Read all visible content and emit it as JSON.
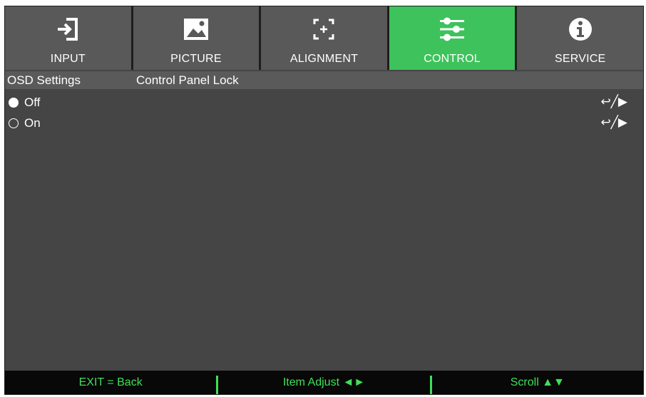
{
  "tabs": [
    {
      "label": "INPUT",
      "icon": "input-icon",
      "active": false
    },
    {
      "label": "PICTURE",
      "icon": "picture-icon",
      "active": false
    },
    {
      "label": "ALIGNMENT",
      "icon": "alignment-icon",
      "active": false
    },
    {
      "label": "CONTROL",
      "icon": "control-sliders-icon",
      "active": true
    },
    {
      "label": "SERVICE",
      "icon": "info-icon",
      "active": false
    }
  ],
  "breadcrumb": {
    "section": "OSD Settings",
    "page": "Control Panel Lock"
  },
  "options": [
    {
      "label": "Off",
      "selected": true,
      "hint": "↩╱▶"
    },
    {
      "label": "On",
      "selected": false,
      "hint": "↩╱▶"
    }
  ],
  "footer": {
    "exit": "EXIT = Back",
    "adjust": "Item Adjust ◄►",
    "scroll": "Scroll ▲▼"
  },
  "colors": {
    "active_tab": "#3ec25b",
    "footer_text": "#3ee058",
    "background": "#454545"
  }
}
